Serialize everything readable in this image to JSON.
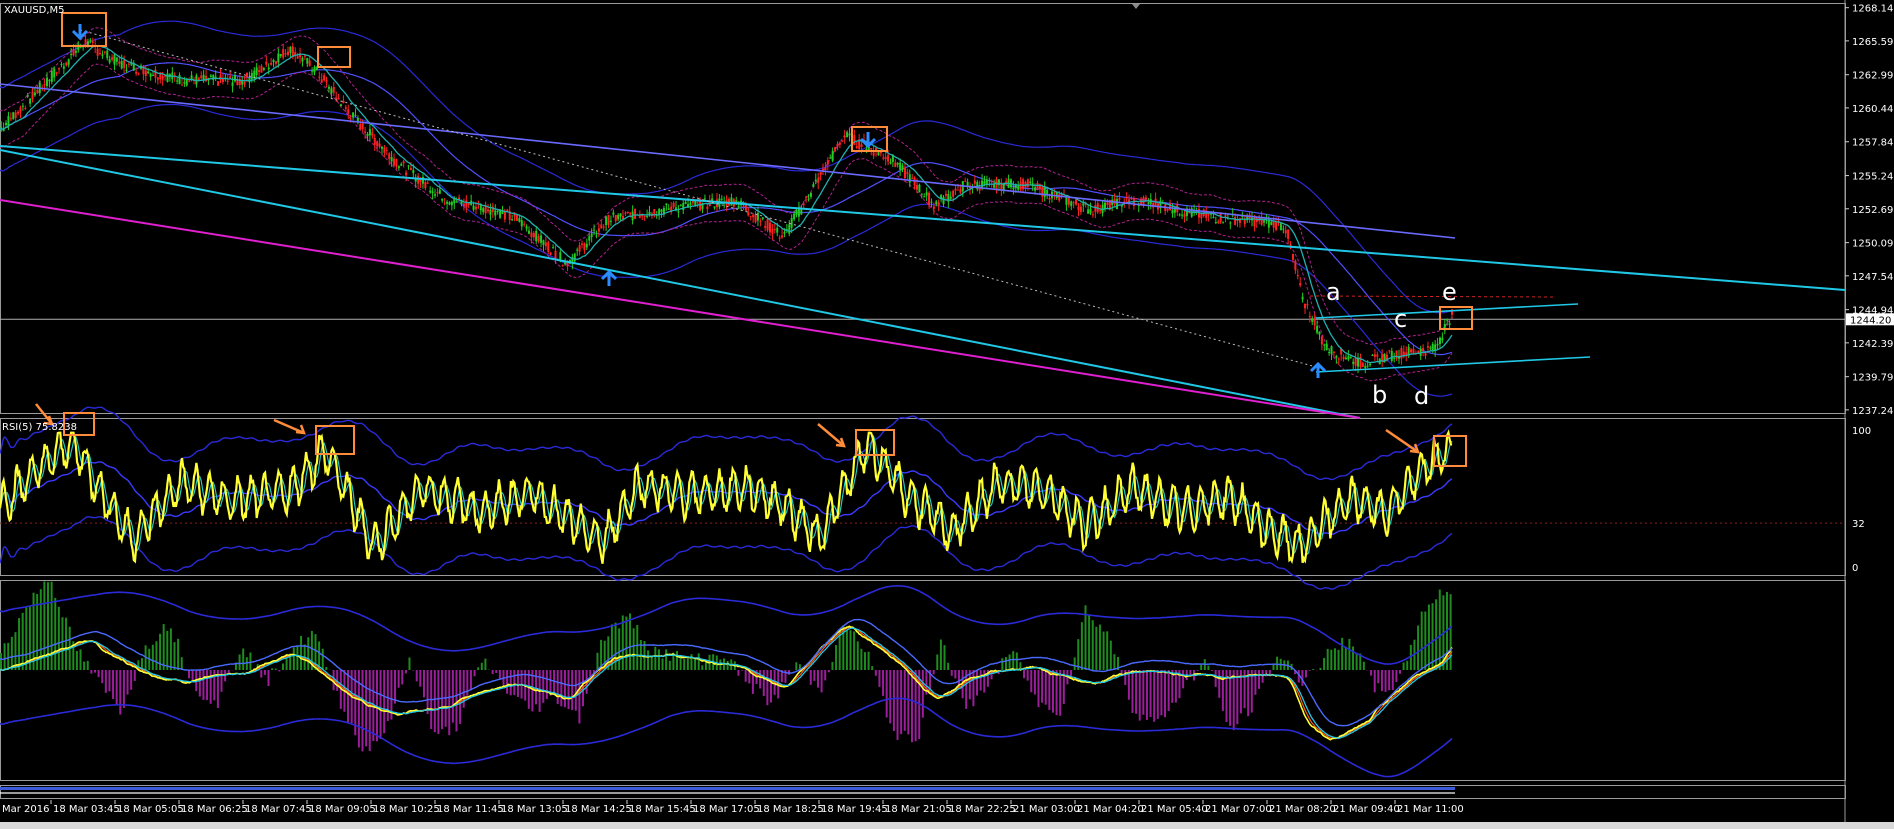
{
  "symbol_label": "XAUUSD,M5",
  "rsi_label": "RSI(5) 75.8238",
  "colors": {
    "background": "#000000",
    "bull": "#22cc22",
    "bear": "#ff2222",
    "channel": "#20c8e6",
    "magenta_line": "#e020d0",
    "band": "#2a2ad8",
    "marker_box": "#ff8c3a",
    "arrow": "#2a8cff",
    "rsi_line": "#ffff33",
    "hist_pos": "#1e8c1e",
    "hist_neg": "#9b1f9b"
  },
  "wave_labels": [
    "a",
    "b",
    "c",
    "d",
    "e"
  ],
  "chart_data": [
    {
      "type": "line",
      "title": "XAUUSD,M5",
      "series": [
        {
          "name": "",
          "x_index": [
            0,
            70,
            100,
            150,
            200,
            215,
            240,
            260,
            290,
            330,
            370,
            410,
            430,
            470,
            505,
            560,
            610,
            650,
            700,
            740,
            775,
            800,
            850,
            905,
            935,
            960,
            985,
            1010,
            1040,
            1066,
            1080,
            1100,
            1130,
            1160,
            1190,
            1205
          ],
          "values": [
            1258.8,
            1265.5,
            1263.8,
            1262.6,
            1262.5,
            1263.3,
            1265.0,
            1263.5,
            1260.0,
            1256.2,
            1253.4,
            1252.6,
            1251.8,
            1248.5,
            1251.9,
            1252.8,
            1253.3,
            1250.5,
            1258.3,
            1256.5,
            1253.0,
            1254.5,
            1254.6,
            1252.6,
            1253.3,
            1253.1,
            1252.4,
            1252.0,
            1251.8,
            1251.4,
            1246.0,
            1242.0,
            1240.8,
            1241.6,
            1241.9,
            1244.7
          ]
        }
      ],
      "y_ticks": [
        1268.14,
        1265.59,
        1262.99,
        1260.44,
        1257.84,
        1255.24,
        1252.69,
        1250.09,
        1247.54,
        1244.94,
        1242.39,
        1239.79,
        1237.24
      ],
      "current_price": "1244.20",
      "ylim": [
        1237.0,
        1268.5
      ]
    },
    {
      "type": "line",
      "title": "RSI(5) 75.8238",
      "y_ticks": [
        100,
        32,
        0
      ],
      "ylim": [
        0,
        100
      ],
      "series": [
        {
          "name": "",
          "x_index": [
            0,
            30,
            60,
            80,
            110,
            150,
            190,
            240,
            270,
            310,
            350,
            400,
            440,
            470,
            500,
            530,
            570,
            620,
            650,
            680,
            720,
            750,
            790,
            830,
            870,
            900,
            940,
            980,
            1020,
            1050,
            1080,
            1120,
            1150,
            1180,
            1200
          ],
          "values": [
            45,
            70,
            92,
            60,
            20,
            62,
            48,
            55,
            85,
            15,
            58,
            40,
            55,
            35,
            18,
            60,
            52,
            58,
            45,
            22,
            90,
            55,
            25,
            62,
            55,
            30,
            58,
            40,
            52,
            28,
            15,
            50,
            40,
            70,
            85
          ]
        }
      ]
    },
    {
      "type": "bar",
      "title": "",
      "series": [
        {
          "name": "",
          "x_index": [
            0,
            20,
            40,
            60,
            80,
            100,
            120,
            140,
            160,
            180,
            200,
            220,
            240,
            260,
            280,
            300,
            320,
            340,
            360,
            380,
            400,
            420,
            440,
            460,
            480,
            500,
            520,
            540,
            560,
            580,
            600,
            620,
            640,
            660,
            680,
            700,
            720,
            740,
            760,
            780,
            800,
            820,
            840,
            860,
            880,
            900,
            920,
            940,
            960,
            980,
            1000,
            1020,
            1040,
            1060,
            1080,
            1100,
            1120,
            1140,
            1160,
            1180,
            1200
          ],
          "values": [
            12,
            45,
            70,
            20,
            -8,
            -30,
            18,
            35,
            -12,
            -25,
            20,
            -10,
            15,
            28,
            -20,
            -60,
            -45,
            10,
            -50,
            -40,
            8,
            -15,
            -30,
            -20,
            -35,
            25,
            40,
            15,
            10,
            8,
            12,
            -10,
            -25,
            5,
            -15,
            35,
            10,
            -45,
            -55,
            25,
            -30,
            -10,
            15,
            -25,
            -30,
            45,
            25,
            -30,
            -40,
            -15,
            8,
            -45,
            -25,
            12,
            -8,
            10,
            25,
            -15,
            -10,
            45,
            60
          ]
        }
      ]
    }
  ],
  "time_labels": [
    "Mar 2016",
    "18 Mar 03:45",
    "18 Mar 05:05",
    "18 Mar 06:25",
    "18 Mar 07:45",
    "18 Mar 09:05",
    "18 Mar 10:25",
    "18 Mar 11:45",
    "18 Mar 13:05",
    "18 Mar 14:25",
    "18 Mar 15:45",
    "18 Mar 17:05",
    "18 Mar 18:25",
    "18 Mar 19:45",
    "18 Mar 21:05",
    "18 Mar 22:25",
    "21 Mar 03:00",
    "21 Mar 04:20",
    "21 Mar 05:40",
    "21 Mar 07:00",
    "21 Mar 08:20",
    "21 Mar 09:40",
    "21 Mar 11:00"
  ]
}
